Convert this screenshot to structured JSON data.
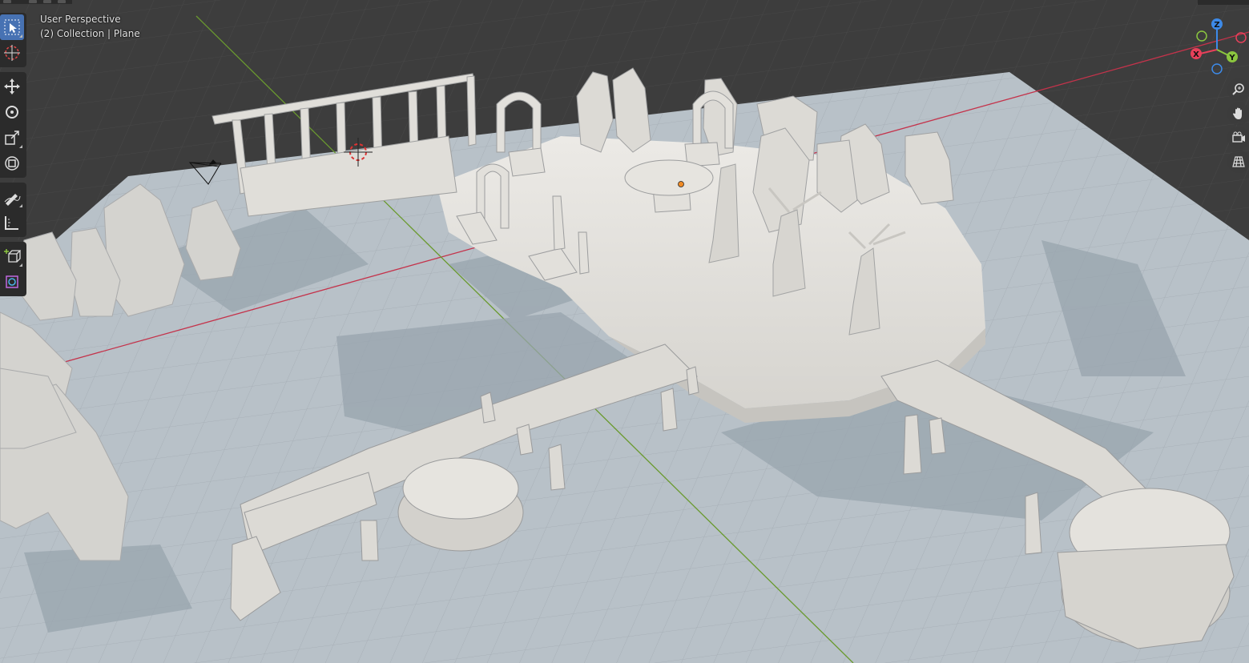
{
  "viewport": {
    "title": "User Perspective",
    "subtitle": "(2) Collection | Plane"
  },
  "toolbar": {
    "tools": [
      {
        "name": "select-box-tool",
        "icon": "select-box-icon",
        "active": true
      },
      {
        "name": "cursor-tool",
        "icon": "cursor-icon"
      },
      {
        "name": "move-tool",
        "icon": "move-icon"
      },
      {
        "name": "rotate-tool",
        "icon": "rotate-icon"
      },
      {
        "name": "scale-tool",
        "icon": "scale-icon"
      },
      {
        "name": "transform-tool",
        "icon": "transform-icon"
      },
      {
        "name": "annotate-tool",
        "icon": "annotate-icon"
      },
      {
        "name": "measure-tool",
        "icon": "measure-icon"
      },
      {
        "name": "add-cube-tool",
        "icon": "add-cube-icon"
      },
      {
        "name": "extra-tool",
        "icon": "extra-tool-icon"
      }
    ]
  },
  "gizmo": {
    "x_label": "X",
    "y_label": "Y",
    "z_label": "Z",
    "x_color": "#e8405a",
    "y_color": "#8bc63f",
    "z_color": "#3d8ae8"
  },
  "nav_buttons": [
    "zoom-icon",
    "pan-hand-icon",
    "camera-view-icon",
    "ortho-grid-icon"
  ],
  "colors": {
    "background": "#3d3d3d",
    "floor": "#b8c1c8",
    "model": "#d9d7d2",
    "shadow": "#98a4ae",
    "x_axis": "#c4334b",
    "y_axis": "#6a9a2f",
    "active_tool": "#4772b3"
  }
}
